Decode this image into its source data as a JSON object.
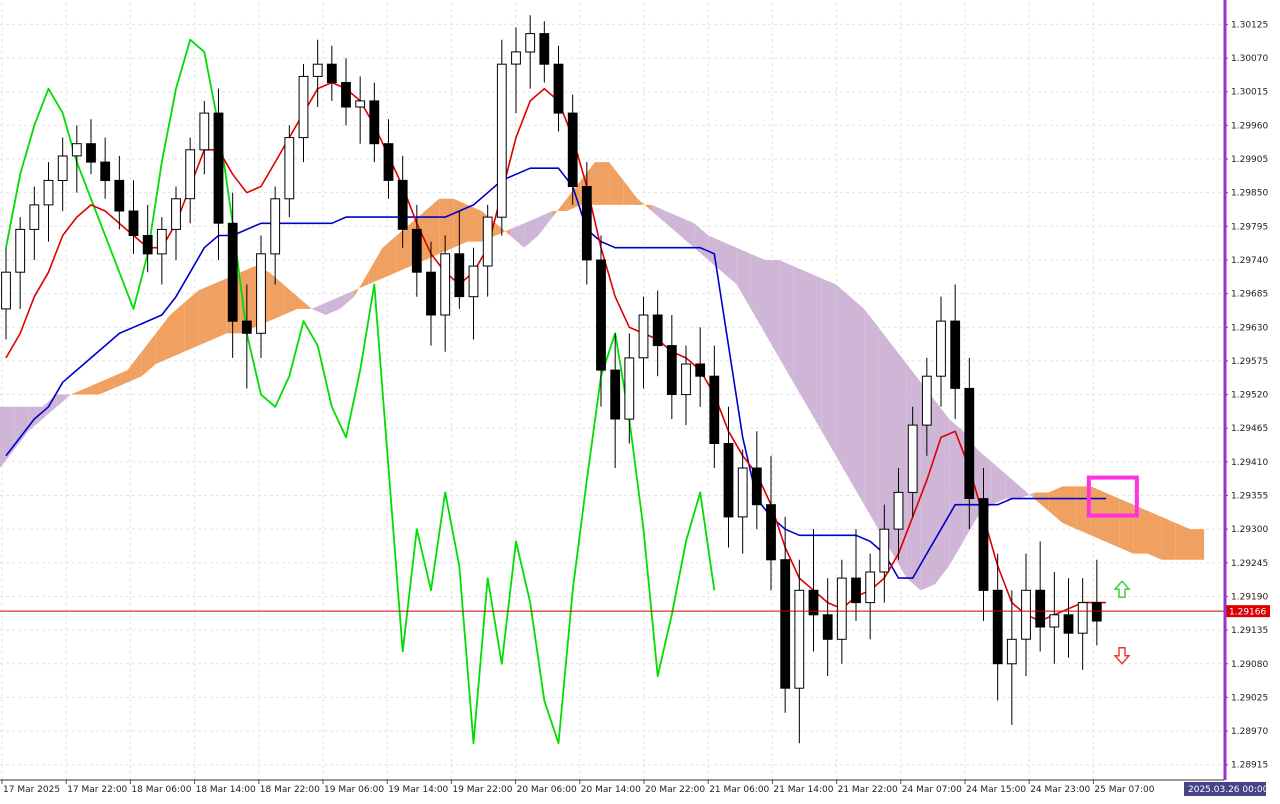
{
  "chart_data": {
    "type": "candlestick",
    "grid": true,
    "ylim": [
      1.2889,
      1.3016
    ],
    "price_ticks": [
      "1.30125",
      "1.30070",
      "1.30015",
      "1.29960",
      "1.29905",
      "1.29850",
      "1.29795",
      "1.29740",
      "1.29685",
      "1.29630",
      "1.29575",
      "1.29520",
      "1.29465",
      "1.29410",
      "1.29355",
      "1.29300",
      "1.29245",
      "1.29190",
      "1.29135",
      "1.29080",
      "1.29025",
      "1.28970",
      "1.28915"
    ],
    "time_labels": [
      "17 Mar 2025",
      "17 Mar 22:00",
      "18 Mar 06:00",
      "18 Mar 14:00",
      "18 Mar 22:00",
      "19 Mar 06:00",
      "19 Mar 14:00",
      "19 Mar 22:00",
      "20 Mar 06:00",
      "20 Mar 14:00",
      "20 Mar 22:00",
      "21 Mar 06:00",
      "21 Mar 14:00",
      "21 Mar 22:00",
      "24 Mar 07:00",
      "24 Mar 15:00",
      "24 Mar 23:00",
      "25 Mar 07:00"
    ],
    "current_price": "1.29166",
    "future_date_label": "2025.03.26 00:00",
    "candles": [
      [
        1.2966,
        1.2976,
        1.2961,
        1.2972
      ],
      [
        1.2972,
        1.2981,
        1.2966,
        1.2979
      ],
      [
        1.2979,
        1.2986,
        1.2974,
        1.2983
      ],
      [
        1.2983,
        1.299,
        1.2977,
        1.2987
      ],
      [
        1.2987,
        1.2994,
        1.2982,
        1.2991
      ],
      [
        1.2991,
        1.2996,
        1.2985,
        1.2993
      ],
      [
        1.2993,
        1.2997,
        1.2988,
        1.299
      ],
      [
        1.299,
        1.2994,
        1.2984,
        1.2987
      ],
      [
        1.2987,
        1.2991,
        1.2979,
        1.2982
      ],
      [
        1.2982,
        1.2987,
        1.2975,
        1.2978
      ],
      [
        1.2978,
        1.2983,
        1.2972,
        1.2975
      ],
      [
        1.2975,
        1.2981,
        1.297,
        1.2979
      ],
      [
        1.2979,
        1.2986,
        1.2974,
        1.2984
      ],
      [
        1.2984,
        1.2994,
        1.298,
        1.2992
      ],
      [
        1.2992,
        1.3,
        1.2988,
        1.2998
      ],
      [
        1.2998,
        1.3002,
        1.2974,
        1.298
      ],
      [
        1.298,
        1.2985,
        1.2958,
        1.2964
      ],
      [
        1.2964,
        1.297,
        1.2953,
        1.2962
      ],
      [
        1.2962,
        1.2978,
        1.2958,
        1.2975
      ],
      [
        1.2975,
        1.2986,
        1.297,
        1.2984
      ],
      [
        1.2984,
        1.2996,
        1.2981,
        1.2994
      ],
      [
        1.2994,
        1.3006,
        1.299,
        1.3004
      ],
      [
        1.3004,
        1.301,
        1.2999,
        1.3006
      ],
      [
        1.3006,
        1.3009,
        1.3,
        1.3003
      ],
      [
        1.3003,
        1.3007,
        1.2996,
        1.2999
      ],
      [
        1.2999,
        1.3004,
        1.2993,
        1.3
      ],
      [
        1.3,
        1.3003,
        1.299,
        1.2993
      ],
      [
        1.2993,
        1.2997,
        1.2984,
        1.2987
      ],
      [
        1.2987,
        1.2991,
        1.2976,
        1.2979
      ],
      [
        1.2979,
        1.2983,
        1.2968,
        1.2972
      ],
      [
        1.2972,
        1.2977,
        1.296,
        1.2965
      ],
      [
        1.2965,
        1.2978,
        1.2959,
        1.2975
      ],
      [
        1.2975,
        1.2982,
        1.2966,
        1.2968
      ],
      [
        1.2968,
        1.2976,
        1.2961,
        1.2973
      ],
      [
        1.2973,
        1.2983,
        1.2968,
        1.2981
      ],
      [
        1.2981,
        1.301,
        1.2978,
        1.3006
      ],
      [
        1.3006,
        1.3012,
        1.2998,
        1.3008
      ],
      [
        1.3008,
        1.3014,
        1.3002,
        1.3011
      ],
      [
        1.3011,
        1.3013,
        1.3003,
        1.3006
      ],
      [
        1.3006,
        1.3009,
        1.2995,
        1.2998
      ],
      [
        1.2998,
        1.3001,
        1.2983,
        1.2986
      ],
      [
        1.2986,
        1.299,
        1.297,
        1.2974
      ],
      [
        1.2974,
        1.2978,
        1.295,
        1.2956
      ],
      [
        1.2956,
        1.2962,
        1.294,
        1.2948
      ],
      [
        1.2948,
        1.2962,
        1.2944,
        1.2958
      ],
      [
        1.2958,
        1.2968,
        1.2953,
        1.2965
      ],
      [
        1.2965,
        1.2969,
        1.2955,
        1.296
      ],
      [
        1.296,
        1.2965,
        1.2948,
        1.2952
      ],
      [
        1.2952,
        1.296,
        1.2947,
        1.2957
      ],
      [
        1.2957,
        1.2963,
        1.295,
        1.2955
      ],
      [
        1.2955,
        1.296,
        1.294,
        1.2944
      ],
      [
        1.2944,
        1.295,
        1.2927,
        1.2932
      ],
      [
        1.2932,
        1.2943,
        1.2926,
        1.294
      ],
      [
        1.294,
        1.2946,
        1.293,
        1.2934
      ],
      [
        1.2934,
        1.2942,
        1.292,
        1.2925
      ],
      [
        1.2925,
        1.2932,
        1.29,
        1.2904
      ],
      [
        1.2904,
        1.2925,
        1.2895,
        1.292
      ],
      [
        1.292,
        1.293,
        1.291,
        1.2916
      ],
      [
        1.2916,
        1.2922,
        1.2906,
        1.2912
      ],
      [
        1.2912,
        1.2925,
        1.2908,
        1.2922
      ],
      [
        1.2922,
        1.293,
        1.2915,
        1.2918
      ],
      [
        1.2918,
        1.2926,
        1.2912,
        1.2923
      ],
      [
        1.2923,
        1.2934,
        1.2918,
        1.293
      ],
      [
        1.293,
        1.294,
        1.2925,
        1.2936
      ],
      [
        1.2936,
        1.295,
        1.2932,
        1.2947
      ],
      [
        1.2947,
        1.2958,
        1.2942,
        1.2955
      ],
      [
        1.2955,
        1.2968,
        1.295,
        1.2964
      ],
      [
        1.2964,
        1.297,
        1.2948,
        1.2953
      ],
      [
        1.2953,
        1.2958,
        1.293,
        1.2935
      ],
      [
        1.2935,
        1.294,
        1.2915,
        1.292
      ],
      [
        1.292,
        1.2926,
        1.2902,
        1.2908
      ],
      [
        1.2908,
        1.292,
        1.2898,
        1.2912
      ],
      [
        1.2912,
        1.2926,
        1.2906,
        1.292
      ],
      [
        1.292,
        1.2928,
        1.291,
        1.2914
      ],
      [
        1.2914,
        1.2923,
        1.2908,
        1.2916
      ],
      [
        1.2916,
        1.2922,
        1.2909,
        1.2913
      ],
      [
        1.2913,
        1.2922,
        1.2907,
        1.2918
      ],
      [
        1.2918,
        1.2925,
        1.2911,
        1.2915
      ]
    ],
    "tenkan": [
      1.2958,
      1.2962,
      1.2968,
      1.2972,
      1.2978,
      1.2981,
      1.2983,
      1.2982,
      1.298,
      1.2978,
      1.2976,
      1.2976,
      1.298,
      1.2986,
      1.2992,
      1.2992,
      1.2988,
      1.2985,
      1.2986,
      1.299,
      1.2994,
      1.2998,
      1.3002,
      1.3003,
      1.3002,
      1.3,
      1.2996,
      1.2991,
      1.2986,
      1.298,
      1.2975,
      1.2972,
      1.297,
      1.2972,
      1.2976,
      1.2985,
      1.2994,
      1.3,
      1.3002,
      1.3,
      1.2994,
      1.2986,
      1.2976,
      1.2968,
      1.2963,
      1.2962,
      1.2961,
      1.2959,
      1.2958,
      1.2956,
      1.2952,
      1.2946,
      1.2942,
      1.2939,
      1.2934,
      1.2927,
      1.2922,
      1.292,
      1.2918,
      1.2917,
      1.2919,
      1.292,
      1.2922,
      1.2926,
      1.2932,
      1.2938,
      1.2945,
      1.2946,
      1.294,
      1.2932,
      1.2924,
      1.2918,
      1.2916,
      1.2915,
      1.2916,
      1.2917,
      1.2918,
      1.2918
    ],
    "kijun": [
      1.2942,
      1.2945,
      1.2948,
      1.295,
      1.2954,
      1.2956,
      1.2958,
      1.296,
      1.2962,
      1.2963,
      1.2964,
      1.2965,
      1.2968,
      1.2972,
      1.2976,
      1.2978,
      1.2978,
      1.2979,
      1.298,
      1.298,
      1.298,
      1.298,
      1.298,
      1.298,
      1.2981,
      1.2981,
      1.2981,
      1.2981,
      1.2981,
      1.2981,
      1.2981,
      1.2981,
      1.2982,
      1.2983,
      1.2985,
      1.2987,
      1.2988,
      1.2989,
      1.2989,
      1.2989,
      1.2986,
      1.2979,
      1.2977,
      1.2976,
      1.2976,
      1.2976,
      1.2976,
      1.2976,
      1.2976,
      1.2976,
      1.2975,
      1.296,
      1.2945,
      1.2935,
      1.2932,
      1.293,
      1.2929,
      1.2929,
      1.2929,
      1.2929,
      1.2929,
      1.2928,
      1.2926,
      1.2922,
      1.2922,
      1.2926,
      1.293,
      1.2934,
      1.2934,
      1.2934,
      1.2934,
      1.2935,
      1.2935,
      1.2935,
      1.2935,
      1.2935,
      1.2935,
      1.2935
    ],
    "chikou": [
      1.2976,
      1.2988,
      1.2996,
      1.3002,
      1.2998,
      1.299,
      1.2984,
      1.2978,
      1.2972,
      1.2966,
      1.2975,
      1.299,
      1.3002,
      1.301,
      1.3008,
      1.2996,
      1.298,
      1.2962,
      1.2952,
      1.295,
      1.2955,
      1.2964,
      1.296,
      1.295,
      1.2945,
      1.2956,
      1.297,
      1.294,
      1.291,
      1.293,
      1.292,
      1.2936,
      1.2924,
      1.2895,
      1.2922,
      1.2908,
      1.2928,
      1.2918,
      1.2902,
      1.2895,
      1.292,
      1.2938,
      1.2955,
      1.2962,
      1.2948,
      1.293,
      1.2906,
      1.2916,
      1.2928,
      1.2936,
      1.292
    ],
    "cloud": {
      "span_a": [
        1.294,
        1.2943,
        1.2946,
        1.2948,
        1.295,
        1.2952,
        1.2953,
        1.2954,
        1.2955,
        1.2956,
        1.2959,
        1.2962,
        1.2965,
        1.2967,
        1.2969,
        1.297,
        1.2971,
        1.2972,
        1.2973,
        1.2972,
        1.297,
        1.2968,
        1.2966,
        1.2965,
        1.2966,
        1.2968,
        1.2972,
        1.2976,
        1.2978,
        1.298,
        1.2982,
        1.2984,
        1.2984,
        1.2983,
        1.2982,
        1.298,
        1.2978,
        1.2976,
        1.2978,
        1.2981,
        1.2984,
        1.2987,
        1.299,
        1.299,
        1.2987,
        1.2984,
        1.2982,
        1.298,
        1.2978,
        1.2976,
        1.2974,
        1.2972,
        1.297,
        1.2966,
        1.2962,
        1.2958,
        1.2954,
        1.295,
        1.2946,
        1.2942,
        1.2938,
        1.2934,
        1.293,
        1.2926,
        1.2922,
        1.292,
        1.2921,
        1.2924,
        1.2928,
        1.2932,
        1.2934,
        1.2935,
        1.2935,
        1.2936,
        1.2936,
        1.2937,
        1.2937,
        1.2937,
        1.2936,
        1.2935,
        1.2934,
        1.2933,
        1.2932,
        1.2931,
        1.293,
        1.293
      ],
      "span_b": [
        1.295,
        1.295,
        1.295,
        1.295,
        1.2952,
        1.2952,
        1.2952,
        1.2952,
        1.2953,
        1.2954,
        1.2955,
        1.2957,
        1.2958,
        1.2959,
        1.296,
        1.2961,
        1.2962,
        1.2962,
        1.2963,
        1.2964,
        1.2965,
        1.2966,
        1.2966,
        1.2967,
        1.2968,
        1.2969,
        1.297,
        1.2971,
        1.2972,
        1.2973,
        1.2974,
        1.2975,
        1.2976,
        1.2977,
        1.2977,
        1.2978,
        1.2979,
        1.298,
        1.2981,
        1.2982,
        1.2982,
        1.2983,
        1.2983,
        1.2983,
        1.2983,
        1.2983,
        1.2983,
        1.2982,
        1.2981,
        1.298,
        1.2978,
        1.2977,
        1.2976,
        1.2975,
        1.2974,
        1.2974,
        1.2973,
        1.2972,
        1.2971,
        1.297,
        1.2968,
        1.2966,
        1.2963,
        1.296,
        1.2957,
        1.2954,
        1.2951,
        1.2948,
        1.2946,
        1.2943,
        1.2941,
        1.2939,
        1.2937,
        1.2935,
        1.2933,
        1.2931,
        1.293,
        1.2929,
        1.2928,
        1.2927,
        1.2926,
        1.2926,
        1.2925,
        1.2925,
        1.2925,
        1.2925
      ]
    },
    "colors": {
      "tenkan": "#dd0000",
      "kijun": "#0000cc",
      "chikou": "#00dd00",
      "cloud_bull": "#f0a060",
      "cloud_bear": "#cfb6d6",
      "bull_body": "#ffffff",
      "bear_body": "#000000",
      "price_line": "#cc0000",
      "price_label_bg": "#dd0000",
      "scale_border": "#9933cc",
      "grid": "#e4e4e4",
      "marker": "#ff33dd",
      "arrow_up": "#33cc33",
      "arrow_down": "#ee3333"
    },
    "icons": [
      "arrow-up-icon",
      "arrow-down-icon"
    ]
  }
}
